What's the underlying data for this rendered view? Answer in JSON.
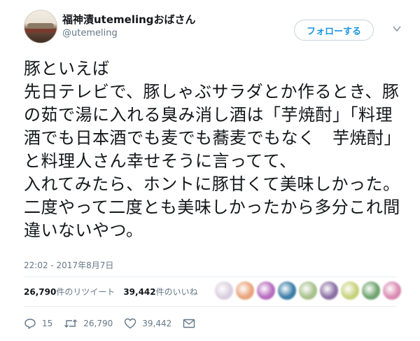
{
  "user": {
    "display_name": "福神漬utemelingおばさん",
    "handle": "@utemeling"
  },
  "follow_button": "フォローする",
  "tweet": {
    "text": "豚といえば\n先日テレビで、豚しゃぶサラダとか作るとき、豚の茹で湯に入れる臭み消し酒は「芋焼酎」「料理酒でも日本酒でも麦でも蕎麦でもなく　芋焼酎」と料理人さん幸せそうに言ってて、\n入れてみたら、ホントに豚甘くて美味しかった。二度やって二度とも美味しかったから多分これ間違いないやつ。",
    "timestamp": "22:02 - 2017年8月7日"
  },
  "stats": {
    "retweet_count": "26,790",
    "retweet_label": "件のリツイート",
    "like_count": "39,442",
    "like_label": "件のいいね"
  },
  "liker_colors": [
    "#d9cfe0",
    "#e8a37b",
    "#b76bbf",
    "#3a7ca8",
    "#a7c08a",
    "#8a6fa3",
    "#c6d27a",
    "#6fa36f",
    "#d98ab0"
  ],
  "actions": {
    "reply_count": "15",
    "retweet_count": "26,790",
    "like_count": "39,442"
  },
  "icons": {
    "reply": "reply-icon",
    "retweet": "retweet-icon",
    "like": "heart-icon",
    "dm": "envelope-icon",
    "caret": "chevron-down-icon"
  },
  "colors": {
    "text": "#14171a",
    "secondary": "#657786",
    "accent": "#1b95e0"
  }
}
